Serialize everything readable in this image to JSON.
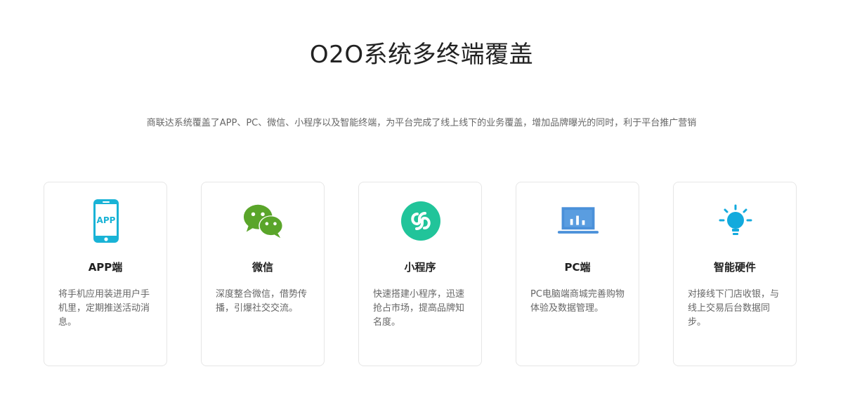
{
  "header": {
    "title": "O2O系统多终端覆盖",
    "subtitle": "商联达系统覆盖了APP、PC、微信、小程序以及智能终端，为平台完成了线上线下的业务覆盖，增加品牌曝光的同时，利于平台推广营销"
  },
  "colors": {
    "app": "#19b3d6",
    "wechat": "#5aa52a",
    "miniprogram": "#21c49a",
    "pc": "#4a90d9",
    "hardware": "#13aadd"
  },
  "cards": [
    {
      "icon": "phone-app-icon",
      "icon_text": "APP",
      "title": "APP端",
      "desc": "将手机应用装进用户手机里，定期推送活动消息。"
    },
    {
      "icon": "wechat-icon",
      "title": "微信",
      "desc": "深度整合微信，借势传播，引爆社交交流。"
    },
    {
      "icon": "miniprogram-icon",
      "title": "小程序",
      "desc": "快速搭建小程序，迅速抢占市场，提高品牌知名度。"
    },
    {
      "icon": "laptop-chart-icon",
      "title": "PC端",
      "desc": "PC电脑端商城完善购物体验及数据管理。"
    },
    {
      "icon": "lightbulb-icon",
      "title": "智能硬件",
      "desc": "对接线下门店收银，与线上交易后台数据同步。"
    }
  ]
}
